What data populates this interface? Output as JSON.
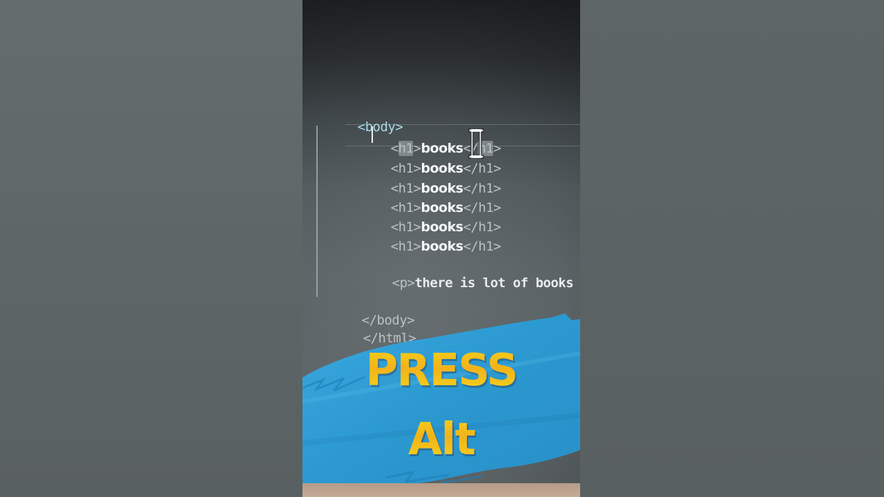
{
  "editor": {
    "lines": [
      {
        "open": "<body>"
      },
      {
        "open_lt": "<",
        "open_tag": "h1",
        "open_gt": ">",
        "text": "books",
        "close_lt": "</",
        "close_tag": "h1",
        "close_gt": ">"
      },
      {
        "open": "<h1>",
        "text": "books",
        "close": "</h1>"
      },
      {
        "open": "<h1>",
        "text": "books",
        "close": "</h1>"
      },
      {
        "open": "<h1>",
        "text": "books",
        "close": "</h1>"
      },
      {
        "open": "<h1>",
        "text": "books",
        "close": "</h1>"
      },
      {
        "open": "<h1>",
        "text": "books",
        "close": "</h1>"
      },
      {
        "open": "<p>",
        "text": "there is lot of books to re"
      },
      {
        "close": "</body>"
      },
      {
        "close": "</html>"
      }
    ]
  },
  "overlay": {
    "line1": "PRESS",
    "line2": "Alt"
  },
  "colors": {
    "overlay_text": "#f5c51a",
    "brush": "#2e9fd6",
    "tag": "#b9c3c6",
    "text": "#f4f6f7"
  },
  "icons": {
    "text_cursor": "i-beam-cursor-icon"
  }
}
